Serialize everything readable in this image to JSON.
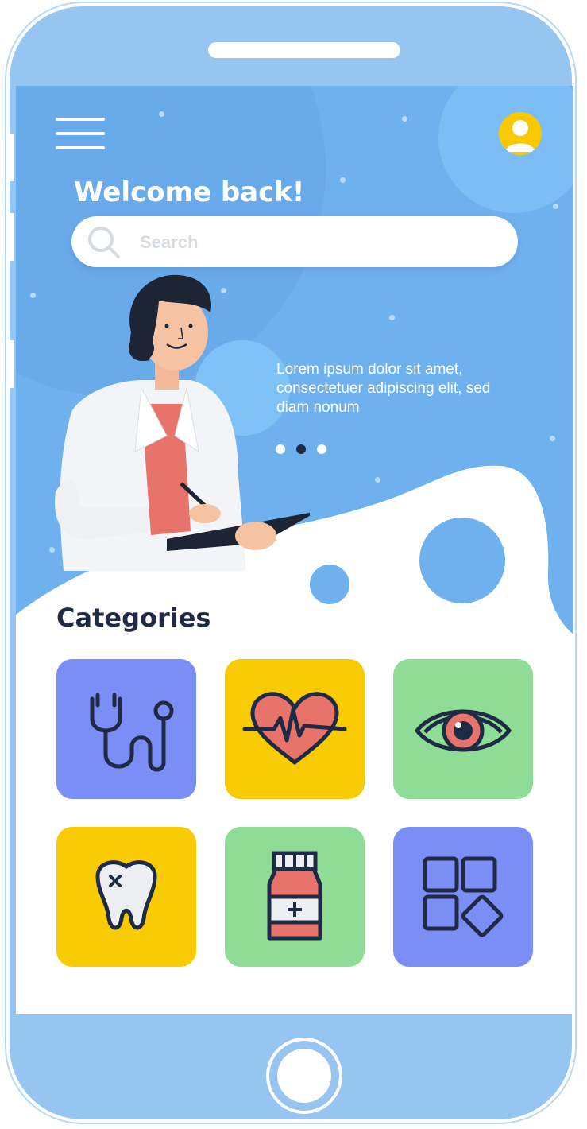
{
  "header": {
    "welcome": "Welcome back!"
  },
  "search": {
    "placeholder": "Search",
    "value": ""
  },
  "banner": {
    "text": "Lorem ipsum dolor sit amet, consectetuer adipiscing elit, sed diam nonum",
    "pages": 3,
    "active_page": 2
  },
  "categories": {
    "title": "Categories",
    "items": [
      {
        "icon": "stethoscope-icon",
        "color": "#7b8ef5"
      },
      {
        "icon": "heartbeat-icon",
        "color": "#f8cb03"
      },
      {
        "icon": "eye-icon",
        "color": "#8fdc96"
      },
      {
        "icon": "tooth-icon",
        "color": "#f8cb03"
      },
      {
        "icon": "medicine-bottle-icon",
        "color": "#8fdc96"
      },
      {
        "icon": "more-categories-icon",
        "color": "#7b8ef5"
      }
    ]
  },
  "colors": {
    "phone_frame": "#96c5f2",
    "screen_bg": "#6fb1ee",
    "accent_dark": "#1f2a44",
    "avatar": "#f8c803"
  }
}
